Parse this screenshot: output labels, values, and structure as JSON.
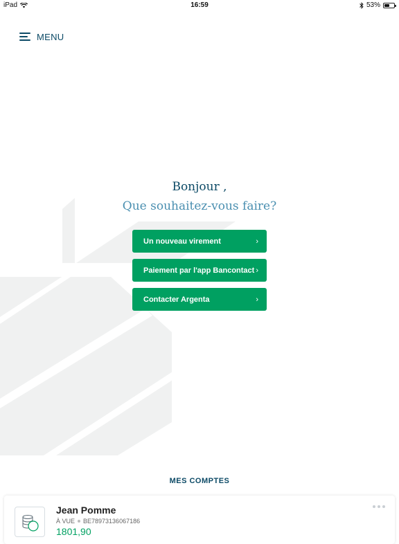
{
  "status_bar": {
    "device": "iPad",
    "time": "16:59",
    "battery": "53%",
    "battery_level": 0.53
  },
  "menu": {
    "label": "MENU"
  },
  "greeting": {
    "hello": "Bonjour ,",
    "question": "Que souhaitez-vous faire?"
  },
  "actions": [
    {
      "label": "Un nouveau virement"
    },
    {
      "label": "Paiement par l'app Bancontact"
    },
    {
      "label": "Contacter Argenta"
    }
  ],
  "accounts_section": {
    "title": "MES COMPTES",
    "account": {
      "name": "Jean Pomme",
      "type": "À VUE",
      "iban": "BE78973136067186",
      "balance": "1801,90"
    }
  },
  "colors": {
    "primary_green": "#00a061",
    "navy": "#0c4a66",
    "light_blue": "#4a8fb0",
    "deco_gray": "#f0f1f1"
  }
}
